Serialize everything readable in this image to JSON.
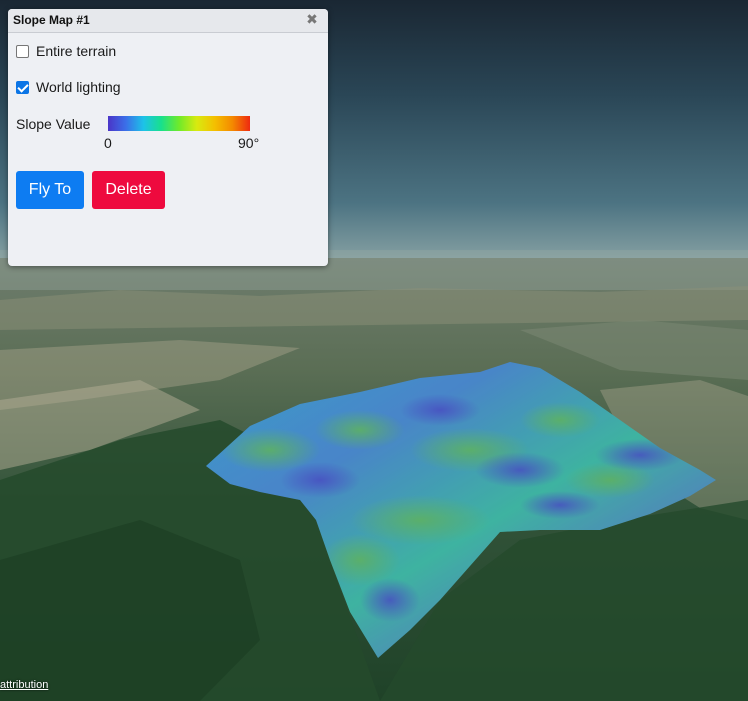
{
  "panel": {
    "title": "Slope Map #1",
    "close_icon": "close-icon",
    "entire_terrain": {
      "label": "Entire terrain",
      "checked": false
    },
    "world_lighting": {
      "label": "World lighting",
      "checked": true
    },
    "legend": {
      "label": "Slope Value",
      "min": "0",
      "max": "90°",
      "colors": [
        "#4a35c8",
        "#3b6fe8",
        "#1dc2e8",
        "#18e08c",
        "#6fea2a",
        "#d8ea10",
        "#f4c000",
        "#f48a00",
        "#ee2a10"
      ]
    },
    "fly_to_label": "Fly To",
    "delete_label": "Delete",
    "fly_to_color": "#0d7cf2",
    "delete_color": "#ee0a3e"
  },
  "viewer": {
    "attribution": "attribution"
  }
}
